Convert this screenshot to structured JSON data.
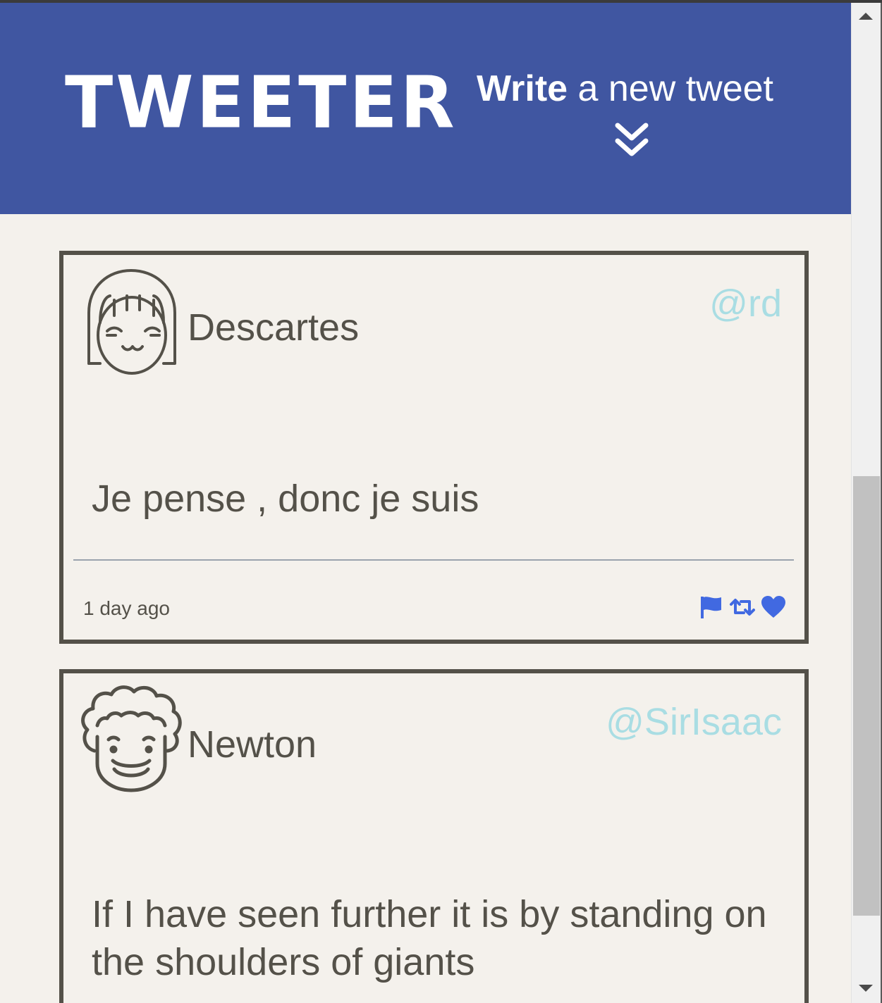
{
  "header": {
    "brand": "TWEETER",
    "compose_bold": "Write",
    "compose_rest": " a new tweet",
    "compose_icon": "double-chevron-down-icon"
  },
  "tweets": [
    {
      "name": "Descartes",
      "handle": "@rd",
      "avatar": "girl-avatar-icon",
      "content": "Je pense , donc je suis",
      "timestamp": "1 day ago",
      "actions": [
        "flag-icon",
        "retweet-icon",
        "heart-icon"
      ]
    },
    {
      "name": "Newton",
      "handle": "@SirIsaac",
      "avatar": "curly-hair-avatar-icon",
      "content": "If I have seen further it is by standing on the shoulders of giants"
    }
  ],
  "colors": {
    "header_bg": "#4056a1",
    "page_bg": "#f4f1ec",
    "card_border": "#545149",
    "handle": "#a9dde3",
    "action_icons": "#4169e1"
  }
}
